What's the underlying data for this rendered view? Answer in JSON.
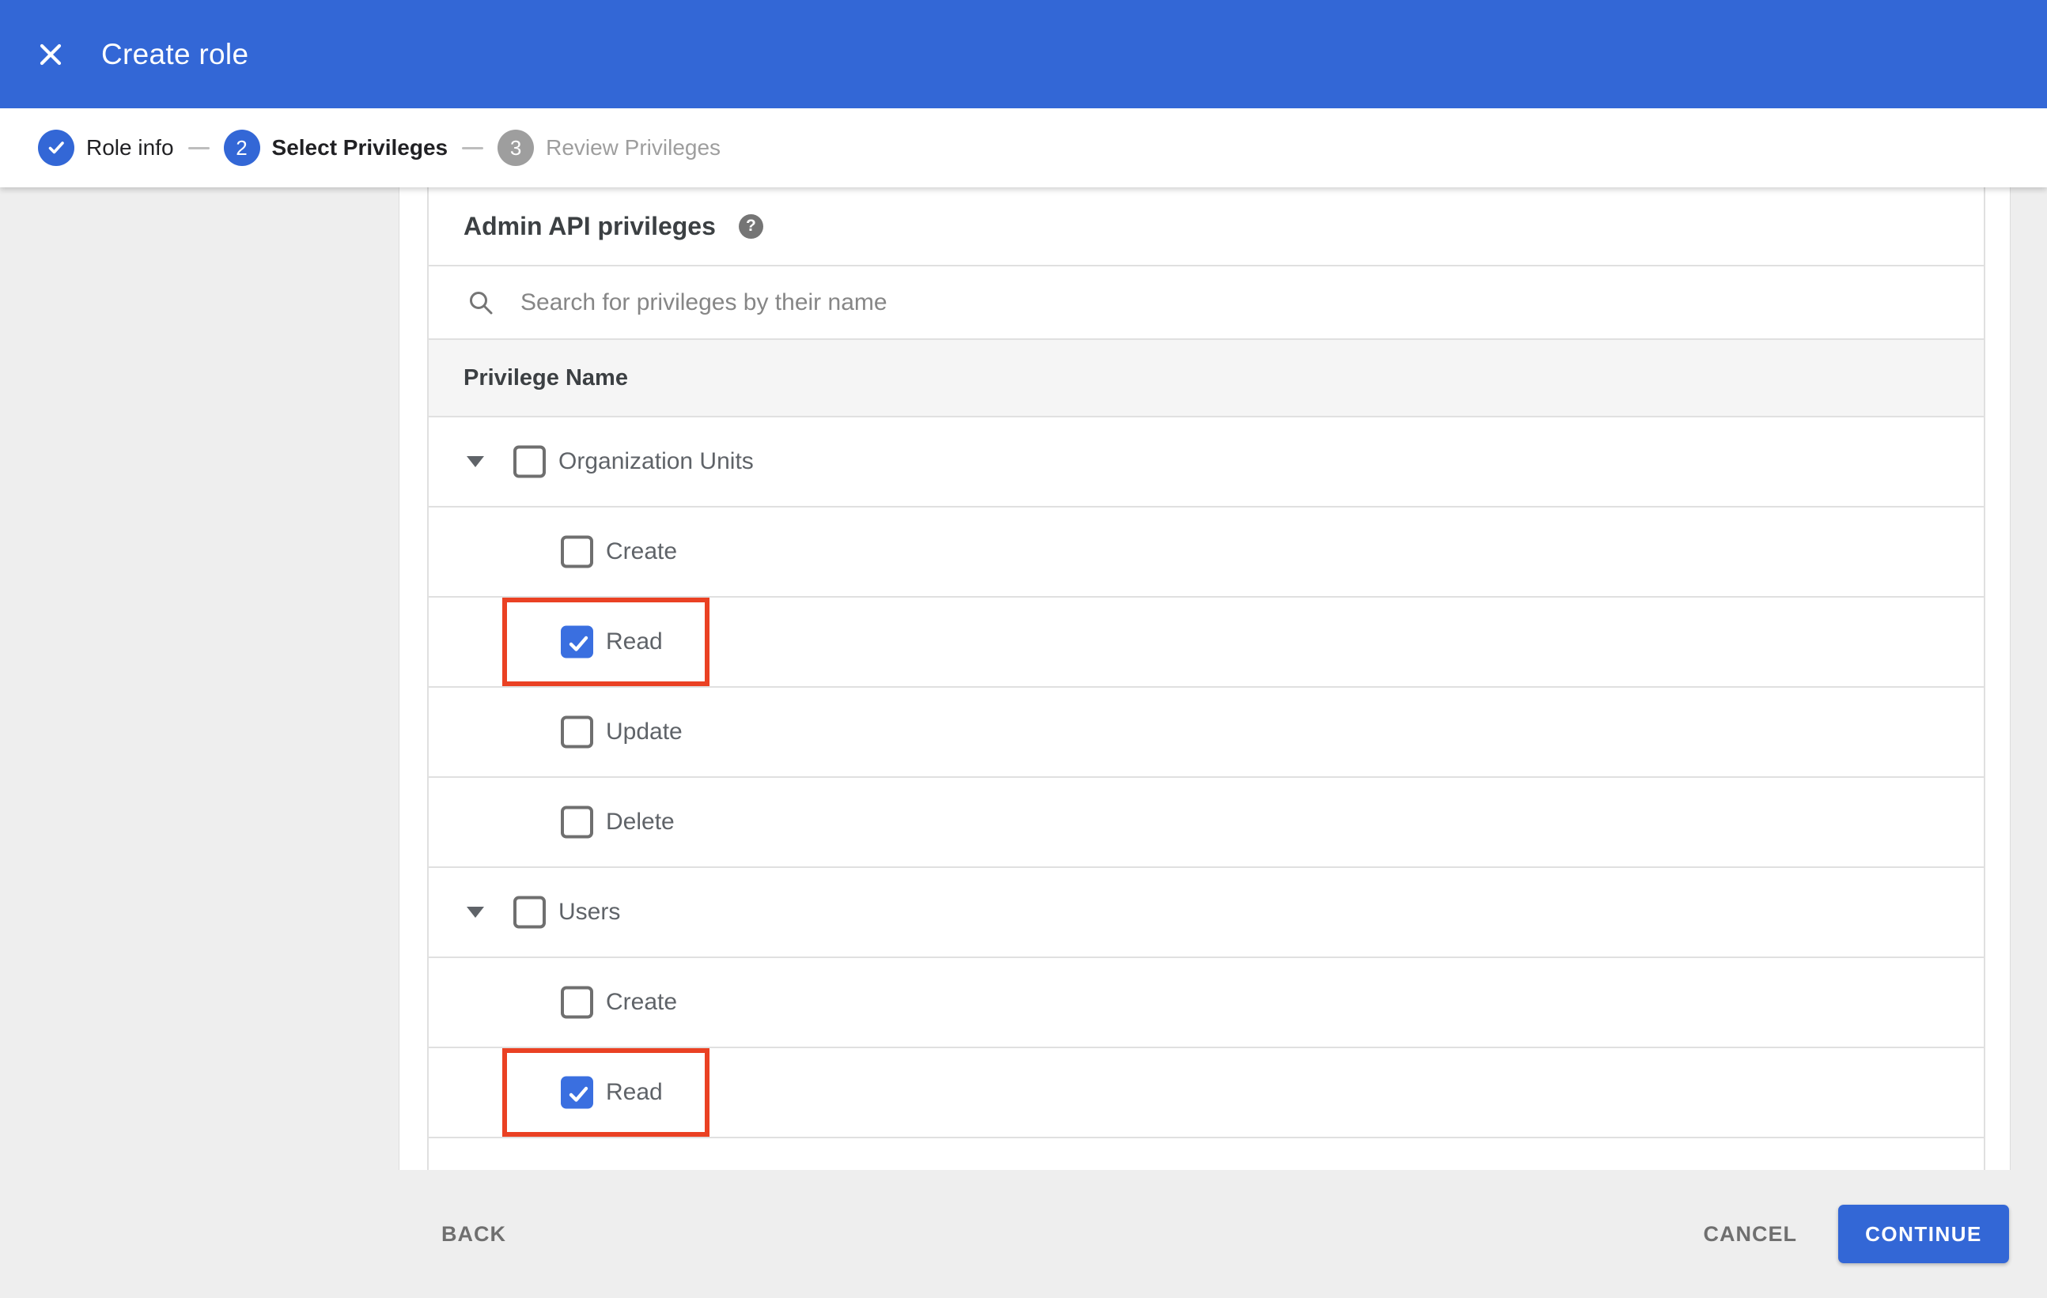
{
  "app_bar": {
    "title": "Create role",
    "close_icon": "x-icon"
  },
  "stepper": {
    "steps": [
      {
        "id": "role-info",
        "label": "Role info",
        "state": "completed",
        "indicator": "check-icon"
      },
      {
        "id": "select-privileges",
        "label": "Select Privileges",
        "state": "active",
        "number": "2"
      },
      {
        "id": "review-privileges",
        "label": "Review Privileges",
        "state": "upcoming",
        "number": "3"
      }
    ]
  },
  "content": {
    "heading": "Admin API privileges",
    "help_icon": "help-circle-icon",
    "search": {
      "icon": "search-icon",
      "placeholder": "Search for privileges by their name",
      "value": ""
    },
    "table": {
      "column_header": "Privilege Name",
      "rows": [
        {
          "label": "Organization Units",
          "type": "parent",
          "expanded": true,
          "checked": false,
          "highlighted": false
        },
        {
          "label": "Create",
          "type": "child",
          "checked": false,
          "highlighted": false
        },
        {
          "label": "Read",
          "type": "child",
          "checked": true,
          "highlighted": true
        },
        {
          "label": "Update",
          "type": "child",
          "checked": false,
          "highlighted": false
        },
        {
          "label": "Delete",
          "type": "child",
          "checked": false,
          "highlighted": false
        },
        {
          "label": "Users",
          "type": "parent",
          "expanded": true,
          "checked": false,
          "highlighted": false
        },
        {
          "label": "Create",
          "type": "child",
          "checked": false,
          "highlighted": false
        },
        {
          "label": "Read",
          "type": "child",
          "checked": true,
          "highlighted": true
        }
      ]
    }
  },
  "footer": {
    "back_label": "BACK",
    "cancel_label": "CANCEL",
    "continue_label": "CONTINUE"
  },
  "colors": {
    "app_bar_blue": "#3367d6",
    "accent_blue": "#3a6fe0",
    "step_inactive_gray": "#9e9e9e",
    "highlight_red": "#ea4123",
    "page_bg": "#eeeeee",
    "divider": "#e0e0e0",
    "header_row_bg": "#f5f5f5"
  }
}
